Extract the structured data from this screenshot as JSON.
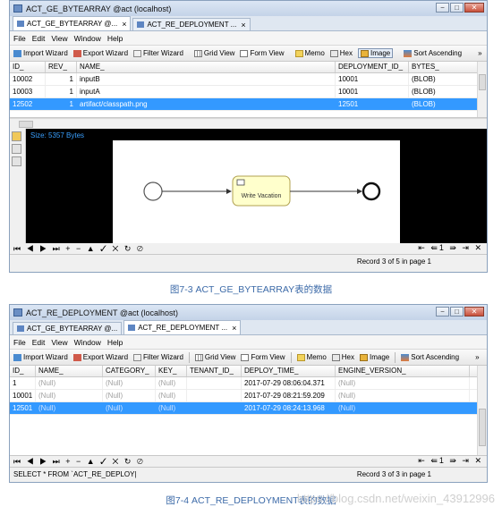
{
  "window1": {
    "title": "ACT_GE_BYTEARRAY @act (localhost)",
    "tabs": [
      {
        "label": "ACT_GE_BYTEARRAY @...",
        "close": "×",
        "active": true
      },
      {
        "label": "ACT_RE_DEPLOYMENT ...",
        "close": "×",
        "active": false
      }
    ],
    "menu": [
      "File",
      "Edit",
      "View",
      "Window",
      "Help"
    ],
    "toolbar": {
      "import_wizard": "Import Wizard",
      "export_wizard": "Export Wizard",
      "filter_wizard": "Filter Wizard",
      "grid_view": "Grid View",
      "form_view": "Form View",
      "memo": "Memo",
      "hex": "Hex",
      "image": "Image",
      "sort_ascending": "Sort Ascending",
      "overflow": "»"
    },
    "columns": [
      "ID_",
      "REV_",
      "NAME_",
      "DEPLOYMENT_ID_",
      "BYTES_"
    ],
    "rows": [
      {
        "id": "10002",
        "rev": "1",
        "name": "inputB",
        "deployment_id": "10001",
        "bytes": "(BLOB)",
        "selected": false
      },
      {
        "id": "10003",
        "rev": "1",
        "name": "inputA",
        "deployment_id": "10001",
        "bytes": "(BLOB)",
        "selected": false
      },
      {
        "id": "12502",
        "rev": "1",
        "name": "artifact/classpath.png",
        "deployment_id": "12501",
        "bytes": "(BLOB)",
        "selected": true
      }
    ],
    "blob_size": "Size: 5357 Bytes",
    "diagram_task_label": "Write Vacation",
    "nav_left": "⏮ ◀ ▶ ⏭ + − ▲ ✓ ✕ ↻ ⊘",
    "nav_right": "⇤ ⇚1 ⇛ ⇥ ✕",
    "record_status": "Record 3 of 5 in page 1"
  },
  "caption1": "图7-3 ACT_GE_BYTEARRAY表的数据",
  "window2": {
    "title": "ACT_RE_DEPLOYMENT @act (localhost)",
    "tabs": [
      {
        "label": "ACT_GE_BYTEARRAY @...",
        "close": "",
        "active": false
      },
      {
        "label": "ACT_RE_DEPLOYMENT ...",
        "close": "×",
        "active": true
      }
    ],
    "menu": [
      "File",
      "Edit",
      "View",
      "Window",
      "Help"
    ],
    "toolbar": {
      "import_wizard": "Import Wizard",
      "export_wizard": "Export Wizard",
      "filter_wizard": "Filter Wizard",
      "grid_view": "Grid View",
      "form_view": "Form View",
      "memo": "Memo",
      "hex": "Hex",
      "image": "Image",
      "sort_ascending": "Sort Ascending",
      "overflow": "»"
    },
    "columns": [
      "ID_",
      "NAME_",
      "CATEGORY_",
      "KEY_",
      "TENANT_ID_",
      "DEPLOY_TIME_",
      "ENGINE_VERSION_"
    ],
    "rows": [
      {
        "id": "1",
        "name": "(Null)",
        "category": "(Null)",
        "key": "(Null)",
        "tenant": "",
        "time": "2017-07-29 08:06:04.371",
        "engine": "(Null)",
        "selected": false
      },
      {
        "id": "10001",
        "name": "(Null)",
        "category": "(Null)",
        "key": "(Null)",
        "tenant": "",
        "time": "2017-07-29 08:21:59.209",
        "engine": "(Null)",
        "selected": false
      },
      {
        "id": "12501",
        "name": "(Null)",
        "category": "(Null)",
        "key": "(Null)",
        "tenant": "",
        "time": "2017-07-29 08:24:13.968",
        "engine": "(Null)",
        "selected": true
      }
    ],
    "nav_left": "⏮ ◀ ▶ ⏭ + − ▲ ✓ ✕ ↻ ⊘",
    "nav_right": "⇤ ⇚1 ⇛ ⇥ ✕",
    "sql_text": "SELECT * FROM `ACT_RE_DEPLOY|",
    "record_status": "Record 3 of 3 in page 1"
  },
  "caption2": "图7-4 ACT_RE_DEPLOYMENT表的数据",
  "watermark": "https://blog.csdn.net/weixin_43912996"
}
